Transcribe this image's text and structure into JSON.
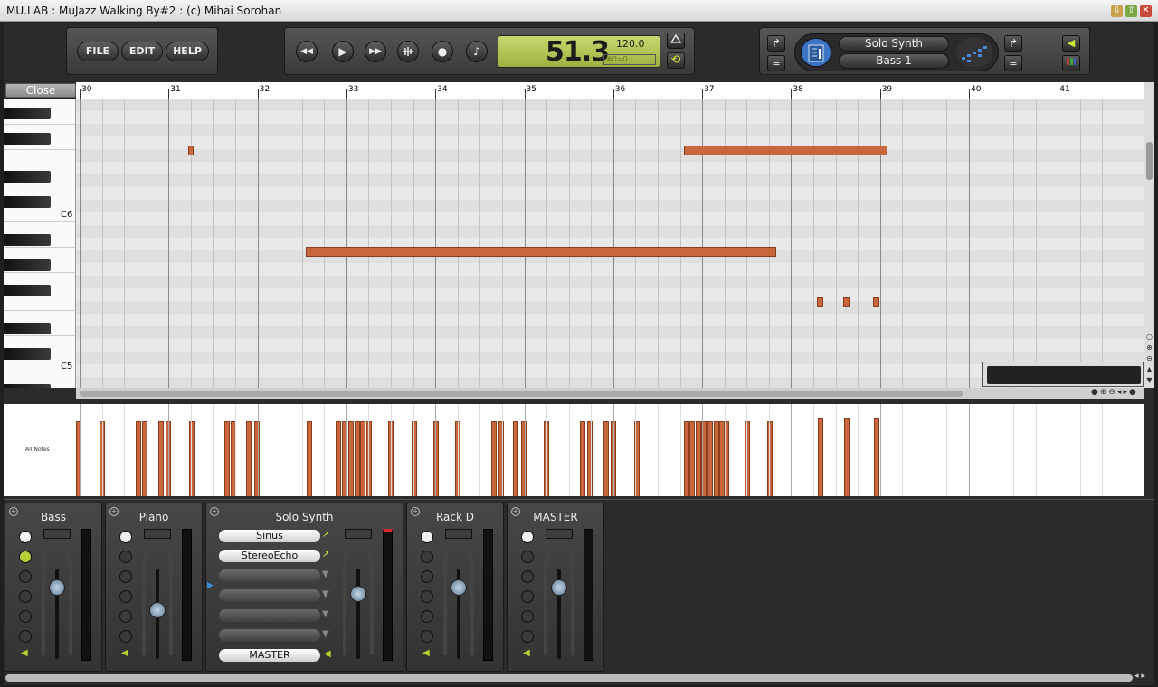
{
  "window": {
    "title": "MU.LAB : MuJazz Walking By#2 : (c) Mihai Sorohan",
    "btn_min": "⇩",
    "btn_max": "⇧",
    "btn_close": "✕"
  },
  "toolbar": {
    "file": "FILE",
    "edit": "EDIT",
    "help": "HELP"
  },
  "transport": {
    "rewind": "◀◀",
    "play": "▶",
    "forward": "▶▶",
    "rec": "●",
    "note": "♪",
    "position": "51.3",
    "tempo": "120.0",
    "sub": "#0=0"
  },
  "instrument": {
    "name": "Solo Synth",
    "part": "Bass 1"
  },
  "editor": {
    "close": "Close",
    "bars": [
      "30",
      "31",
      "32",
      "33",
      "34",
      "35",
      "36",
      "37",
      "38",
      "39",
      "40",
      "41"
    ],
    "key_labels": [
      "C6",
      "C5"
    ],
    "velocity_label": "All Notes"
  },
  "mixer": {
    "channels": [
      {
        "name": "Bass"
      },
      {
        "name": "Piano"
      },
      {
        "name": "Solo Synth",
        "slots": [
          "Sinus",
          "StereoEcho",
          "",
          "",
          "",
          ""
        ],
        "output": "MASTER"
      },
      {
        "name": "Rack D"
      },
      {
        "name": "MASTER"
      }
    ]
  }
}
